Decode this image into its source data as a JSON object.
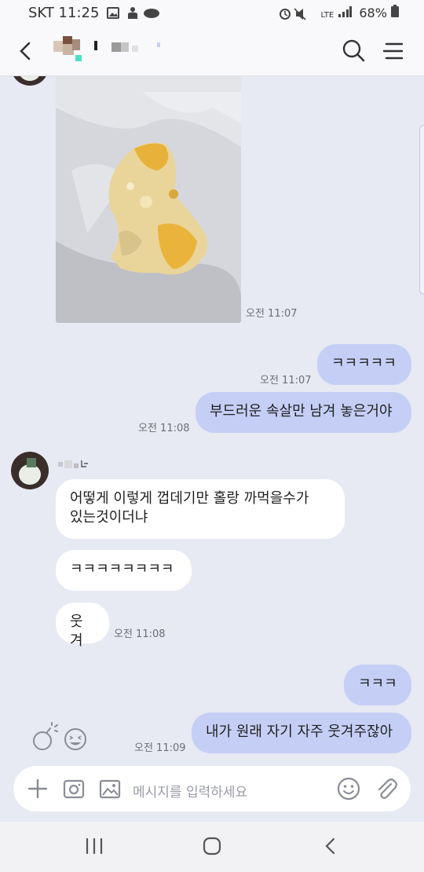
{
  "status_bar": {
    "time": "SKT 11:25",
    "network": "LTE",
    "battery": "68%",
    "icons": [
      "image-icon",
      "android-icon",
      "cloud-icon",
      "alarm-icon",
      "mute-icon",
      "signal-icon",
      "battery-icon"
    ]
  },
  "header": {
    "icons": [
      "back-arrow-icon",
      "search-icon",
      "menu-icon"
    ]
  },
  "messages": {
    "m1": {
      "time": "오전 11:07"
    },
    "m2": {
      "text": "ㅋㅋㅋㅋㅋ",
      "time": "오전 11:07"
    },
    "m3": {
      "text": "부드러운 속살만 남겨 놓은거야",
      "time": "오전 11:08"
    },
    "m4": {
      "text_line1": "어떻게 이렇게 껍데기만 홀랑 까먹을수가",
      "text_line2": "있는것이더냐"
    },
    "m5": {
      "text": "ㅋㅋㅋㅋㅋㅋㅋㅋ"
    },
    "m6": {
      "text": "웃겨",
      "time": "오전 11:08"
    },
    "m7": {
      "text": "ㅋㅋㅋ"
    },
    "m8": {
      "text": "내가 원래 자기 자주 웃겨주잖아",
      "time": "오전 11:09"
    }
  },
  "input": {
    "placeholder": "메시지를 입력하세요",
    "icons": [
      "plus-icon",
      "camera-icon",
      "gallery-icon",
      "emoji-icon",
      "attach-icon"
    ]
  },
  "nav": {
    "icons": [
      "recent-apps-icon",
      "home-icon",
      "back-icon"
    ]
  },
  "colors": {
    "chat_bg": "#e7e9f3",
    "outgoing_bubble": "#c5cff6",
    "incoming_bubble": "#ffffff"
  }
}
